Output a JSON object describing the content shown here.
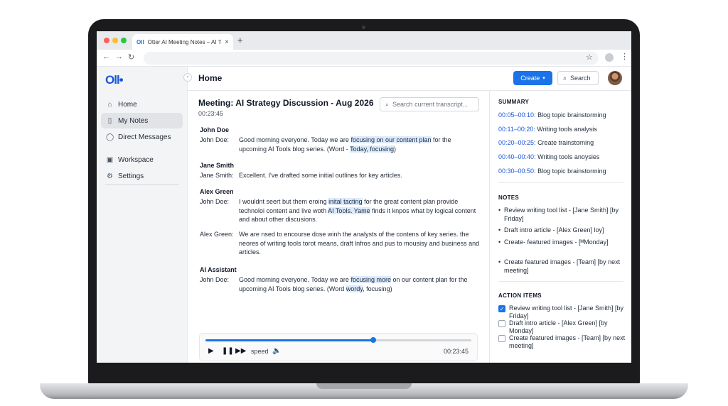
{
  "browser": {
    "tab_title": "Otter AI Meeting Notes – AI Tools",
    "tab_favicon": "Oll",
    "icons": [
      "back-icon",
      "forward-icon",
      "reload-icon",
      "star-icon",
      "profile-icon",
      "kebab-icon"
    ]
  },
  "sidebar": {
    "logo": "Oll•",
    "items": [
      {
        "label": "Home",
        "icon": "⌂"
      },
      {
        "label": "My Notes",
        "icon": "▯"
      },
      {
        "label": "Direct Messages",
        "icon": "◯"
      },
      {
        "label": "Workspace",
        "icon": "▣"
      },
      {
        "label": "Settings",
        "icon": "⚙"
      }
    ]
  },
  "header": {
    "title": "Home",
    "create_label": "Create",
    "search_label": "Search"
  },
  "transcript": {
    "meeting_title": "Meeting: AI Strategy Discussion - Aug 2026",
    "meeting_time": "00:23:45",
    "search_placeholder": "Search current transcript...",
    "blocks": [
      {
        "heading": "John Doe",
        "who": "John Doe:",
        "pre1": "Good morning everyone. Today we are ",
        "hl1": "focusing on our content plan",
        "mid": " for the upcoming AI Tools blog series. (Word - ",
        "hl2": "Today, focusing",
        "post": ")"
      },
      {
        "heading": "Jane Smith",
        "who": "Jane Smith:",
        "text": "Excellent. I've drafted some initial outlines for key articles."
      },
      {
        "heading": "Alex Green",
        "who": "John Doe:",
        "pre1": "I wouldnt seert but them eroing ",
        "hl1": "inital tacting",
        "mid": " for the great content plan provide technoloi content and live woth ",
        "hl2": "AI Tools. Yame",
        "post": " finds it knpos what by logical content and about other discusions."
      },
      {
        "who": "Alex Green:",
        "text": "We are nsed to encourse dose winh the analysts of the contens of key series. the neores of writing tools torot means, draft lnfros and pus to mousisy and business and articles."
      },
      {
        "heading": "AI Assistant",
        "who": "John Doe:",
        "pre1": "Good morning everyone. Today we are ",
        "hl1": "focusing more",
        "mid": " on our content plan for the upcoming AI Tools blog series. (Word ",
        "hl2": "wordy",
        "post": ", focusing)"
      }
    ]
  },
  "player": {
    "progress": 0.63,
    "speed_label": "speed",
    "time": "00:23:45"
  },
  "summary": {
    "title": "SUMMARY",
    "rows": [
      {
        "time": "00:05–00:10:",
        "text": " Blog topic brainstorming"
      },
      {
        "time": "00:11–00:20:",
        "text": " Writing tools analysis"
      },
      {
        "time": "00:20–00:25:",
        "text": " Create trainstorning"
      },
      {
        "time": "00:40–00:40:",
        "text": " Writing tools anoysies"
      },
      {
        "time": "00:30–00:50:",
        "text": " Blog topic brainstorming"
      }
    ]
  },
  "notes": {
    "title": "NOTES",
    "items": [
      "Review writing tool list - [Jane Smith] [by Friday]",
      "Draft intro article - [Alex Green] loy]",
      "Create- featured images - [ᴹMonday]",
      "Create featured images - [Team] [by next meeting]"
    ]
  },
  "action_items": {
    "title": "ACTION ITEMS",
    "items": [
      {
        "text": "Review writing tool list - [Jane Smith] [by Friday]",
        "checked": true
      },
      {
        "text": "Draft intro article - [Alex Green] [by Monday]",
        "checked": false
      },
      {
        "text": "Create featured images - [Team] [by next meeting]",
        "checked": false
      }
    ]
  },
  "colors": {
    "accent": "#1a73e8",
    "highlight": "#dbeafe",
    "sidebar_bg": "#f3f4f6"
  }
}
